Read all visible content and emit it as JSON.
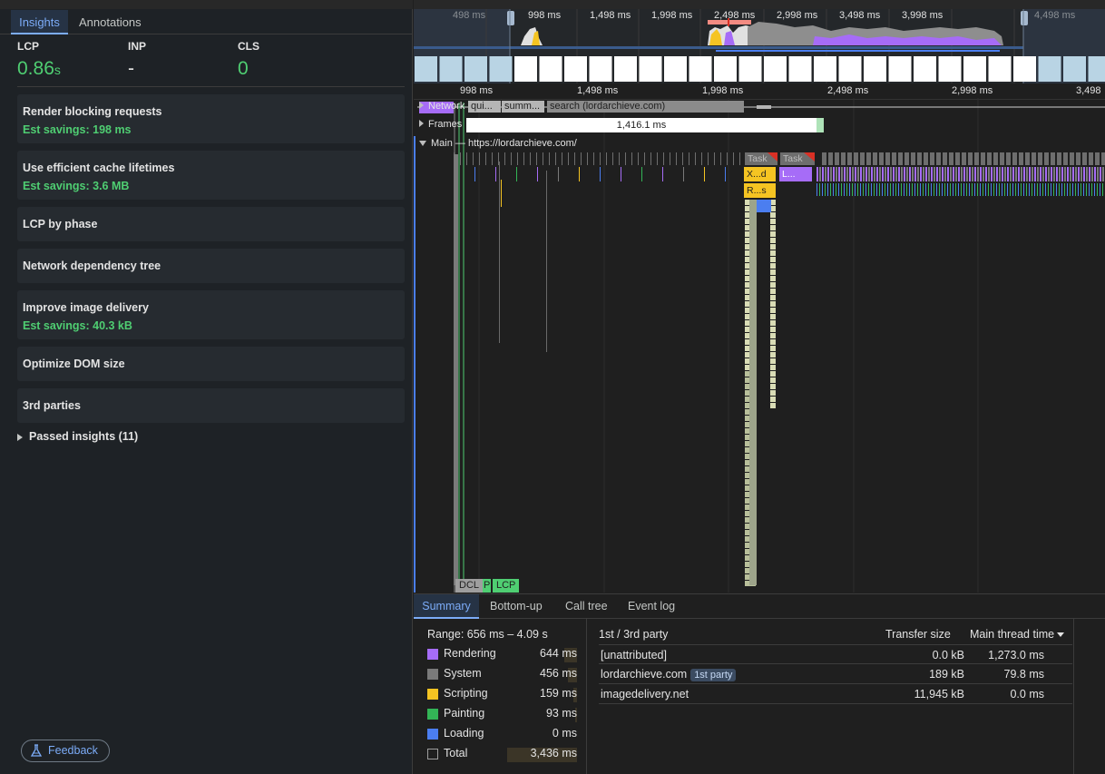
{
  "insights_panel": {
    "tabs": [
      "Insights",
      "Annotations"
    ],
    "metrics": [
      {
        "label": "LCP",
        "value": "0.86",
        "unit": "s"
      },
      {
        "label": "INP",
        "value": "-",
        "unit": ""
      },
      {
        "label": "CLS",
        "value": "0",
        "unit": ""
      }
    ],
    "insights": [
      {
        "title": "Render blocking requests",
        "savings": "Est savings: 198 ms"
      },
      {
        "title": "Use efficient cache lifetimes",
        "savings": "Est savings: 3.6 MB"
      },
      {
        "title": "LCP by phase",
        "savings": ""
      },
      {
        "title": "Network dependency tree",
        "savings": ""
      },
      {
        "title": "Improve image delivery",
        "savings": "Est savings: 40.3 kB"
      },
      {
        "title": "Optimize DOM size",
        "savings": ""
      },
      {
        "title": "3rd parties",
        "savings": ""
      }
    ],
    "passed": "Passed insights (11)",
    "feedback": "Feedback"
  },
  "overview": {
    "ticks": [
      "498 ms",
      "998 ms",
      "1,498 ms",
      "1,998 ms",
      "2,498 ms",
      "2,998 ms",
      "3,498 ms",
      "3,998 ms",
      "4,498 ms"
    ]
  },
  "ruler": {
    "ticks": [
      "998 ms",
      "1,498 ms",
      "1,998 ms",
      "2,498 ms",
      "2,998 ms",
      "3,498"
    ]
  },
  "tracks": {
    "network_label": "Network",
    "network_bars": [
      "qui...",
      "summ...",
      "search (lordarchieve.com)"
    ],
    "frames_label": "Frames",
    "frame_duration": "1,416.1 ms",
    "main_label": "Main — https://lordarchieve.com/",
    "task_labels": [
      "Task",
      "Task"
    ],
    "flame_labels": [
      "X...d",
      "L...",
      "R...s"
    ],
    "markers": {
      "dcl": "DCL",
      "p": "P",
      "lcp": "LCP"
    }
  },
  "bottom": {
    "tabs": [
      "Summary",
      "Bottom-up",
      "Call tree",
      "Event log"
    ],
    "range": "Range: 656 ms – 4.09 s",
    "categories": [
      {
        "name": "Rendering",
        "value": "644 ms",
        "color": "#a66cf7"
      },
      {
        "name": "System",
        "value": "456 ms",
        "color": "#7a7a7a"
      },
      {
        "name": "Scripting",
        "value": "159 ms",
        "color": "#f5c422"
      },
      {
        "name": "Painting",
        "value": "93 ms",
        "color": "#33b556"
      },
      {
        "name": "Loading",
        "value": "0 ms",
        "color": "#4b7ef0"
      },
      {
        "name": "Total",
        "value": "3,436 ms",
        "color": "#1f1f1f"
      }
    ],
    "table": {
      "headers": [
        "1st / 3rd party",
        "Transfer size",
        "Main thread time"
      ],
      "rows": [
        {
          "party": "[unattributed]",
          "badge": "",
          "size": "0.0 kB",
          "time": "1,273.0 ms"
        },
        {
          "party": "lordarchieve.com",
          "badge": "1st party",
          "size": "189 kB",
          "time": "79.8 ms"
        },
        {
          "party": "imagedelivery.net",
          "badge": "",
          "size": "11,945 kB",
          "time": "0.0 ms"
        }
      ]
    }
  }
}
